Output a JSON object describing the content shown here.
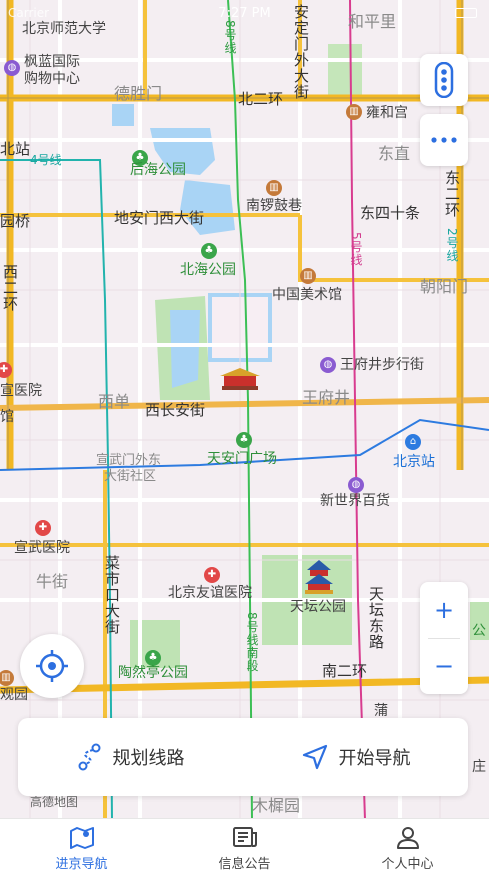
{
  "status_bar": {
    "carrier": "Carrier",
    "time": "7:27 PM"
  },
  "map": {
    "labels": {
      "bnu": "北京师范大学",
      "fenglan": "枫蓝国际",
      "fenglan2": "购物中心",
      "deshengmen": "德胜门",
      "beierhuan": "北二环",
      "yonghegong": "雍和宫",
      "dongzhi": "东直",
      "andingmen_st": "安定门外大街",
      "line8": "8号线",
      "line4": "4号线",
      "line5": "5号线",
      "line2": "2号线",
      "line8s": "8号线南段",
      "station_left": "北站",
      "houhai": "后海公园",
      "nanluoguxiang": "南锣鼓巷",
      "dongsishitiao": "东四十条",
      "dongerhuan": "东二环",
      "diqiao": "园桥",
      "dianmen": "地安门西大街",
      "xierhuan": "西二环",
      "beihai": "北海公园",
      "meishuguan": "中国美术馆",
      "chaoyangmen": "朝阳门",
      "wangfujing_st": "王府井步行街",
      "xuanwu_hosp": "宣医院",
      "guan": "馆",
      "xidan": "西单",
      "xichangan": "西长安街",
      "wangfujing": "王府井",
      "tiananmen": "天安门广场",
      "beijingzhan": "北京站",
      "xuanwumenwai": "宣武门外东",
      "xuanwumenwai2": "大街社区",
      "xinshijie": "新世界百货",
      "xuanwuyiyuan": "宣武医院",
      "niujie": "牛街",
      "caishikou": "菜市口大街",
      "youyi": "北京友谊医院",
      "tiantan": "天坛公园",
      "tiantandong": "天坛东路",
      "taoranting": "陶然亭公园",
      "nanerhuan": "南二环",
      "guanyuan": "观园",
      "muxiyuan": "木樨园",
      "pu": "蒲",
      "zhuang": "庄",
      "gong": "公",
      "gaode": "高德地图",
      "pingan": "和平里"
    }
  },
  "controls": {
    "zoom_in": "+",
    "zoom_out": "−"
  },
  "panel": {
    "plan_route": "规划线路",
    "start_nav": "开始导航"
  },
  "tabs": [
    {
      "label": "进京导航"
    },
    {
      "label": "信息公告"
    },
    {
      "label": "个人中心"
    }
  ],
  "colors": {
    "accent": "#2d6fe0",
    "ring_road": "#f2b824",
    "main_road": "#f5c23c",
    "park": "#bfe3b4",
    "water": "#a9d4f5"
  }
}
